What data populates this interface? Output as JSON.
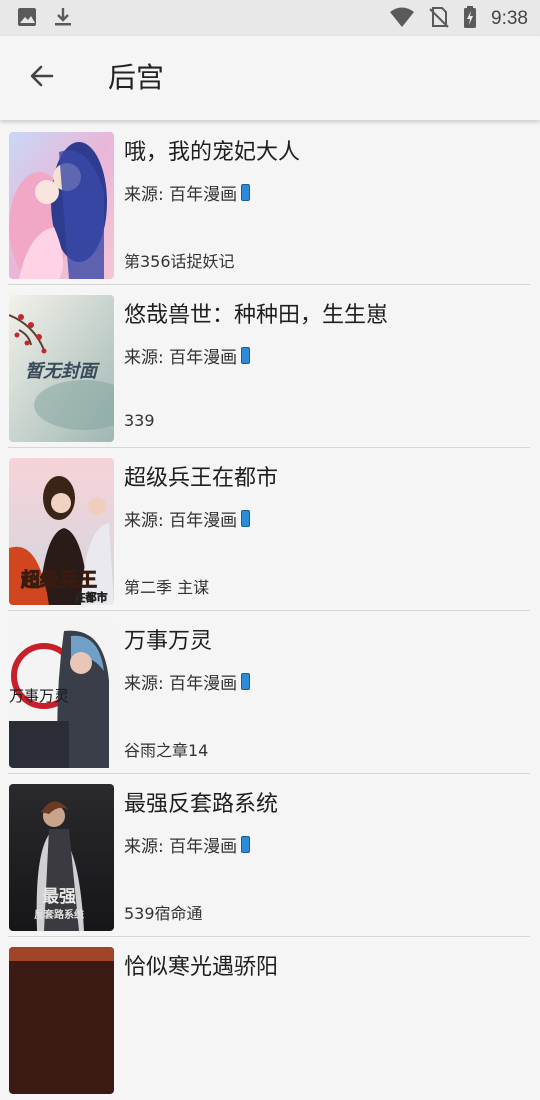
{
  "status_bar": {
    "time": "9:38",
    "icons": [
      "image-icon",
      "download-icon",
      "wifi-icon",
      "no-sim-icon",
      "battery-charging-icon"
    ]
  },
  "header": {
    "title": "后宫",
    "back_icon": "arrow-left-icon"
  },
  "comics": [
    {
      "title": "哦，我的宠妃大人",
      "source": "来源: 百年漫画",
      "latest": "第356话捉妖记"
    },
    {
      "title": "悠哉兽世：种种田，生生崽",
      "source": "来源: 百年漫画",
      "latest": "339",
      "cover_text": "暂无封面"
    },
    {
      "title": "超级兵王在都市",
      "source": "来源: 百年漫画",
      "latest": "第二季 主谋",
      "cover_text": "超级兵王",
      "cover_subtext": "在都市"
    },
    {
      "title": "万事万灵",
      "source": "来源: 百年漫画",
      "latest": "谷雨之章14",
      "cover_text": "万事万灵"
    },
    {
      "title": "最强反套路系统",
      "source": "来源: 百年漫画",
      "latest": "539宿命通",
      "cover_text": "最强",
      "cover_subtext": "反套路系统"
    },
    {
      "title": "恰似寒光遇骄阳",
      "source": "",
      "latest": ""
    }
  ],
  "colors": {
    "status_bar_bg": "#e8e8e8",
    "app_bg": "#f5f5f5",
    "source_badge": "#2d8ad8"
  }
}
